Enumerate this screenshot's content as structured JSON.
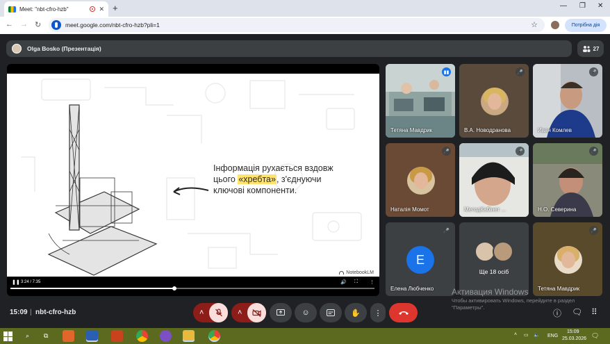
{
  "browser": {
    "tab_title": "Meet: \"nbt-cfro-hzb\"",
    "tab_close": "✕",
    "new_tab": "+",
    "url": "meet.google.com/nbt-cfro-hzb?pli=1",
    "action_button": "Потрібна дія",
    "window_controls": [
      "—",
      "❐",
      "✕"
    ]
  },
  "meeting": {
    "presenter": "Olga Bosko (Презентація)",
    "participant_count": "27",
    "time": "15:09",
    "separator": "|",
    "code": "nbt-cfro-hzb"
  },
  "slide": {
    "line1": "Інформація рухається вздовж",
    "line2_prefix": "цього ",
    "line2_highlight": "«хребта»",
    "line2_suffix": ", з'єднуючи",
    "line3": "ключові компоненти.",
    "brand": "NotebookLM",
    "highlight_color": "#ffe36b"
  },
  "player": {
    "timecode": "3:24 / 7:35",
    "progress": 0.45
  },
  "participants": [
    {
      "name": "Тетяна Мавдрик",
      "speaking": true
    },
    {
      "name": "В.А. Новодранова",
      "muted": true
    },
    {
      "name": "Иван Комлев",
      "muted": true
    },
    {
      "name": "Наталія Момот",
      "muted": true
    },
    {
      "name": "МетодКабінет ...",
      "muted": true
    },
    {
      "name": "Н.О. Северина",
      "muted": true
    },
    {
      "name": "Елена Любченко",
      "letter": "E",
      "muted": true
    },
    {
      "name": "Ще 18 осіб"
    },
    {
      "name": "Тетяна Мавдрик",
      "muted": true
    }
  ],
  "windows_activation": {
    "title": "Активация Windows",
    "subtitle": "Чтобы активировать Windows, перейдите в раздел \"Параметры\"."
  },
  "taskbar": {
    "language": "ENG",
    "time": "15:09",
    "date": "25.03.2026"
  },
  "colors": {
    "meet_bg": "#202124",
    "hangup": "#dc362e",
    "accent": "#1a73e8",
    "taskbar": "#5b6a1f"
  }
}
